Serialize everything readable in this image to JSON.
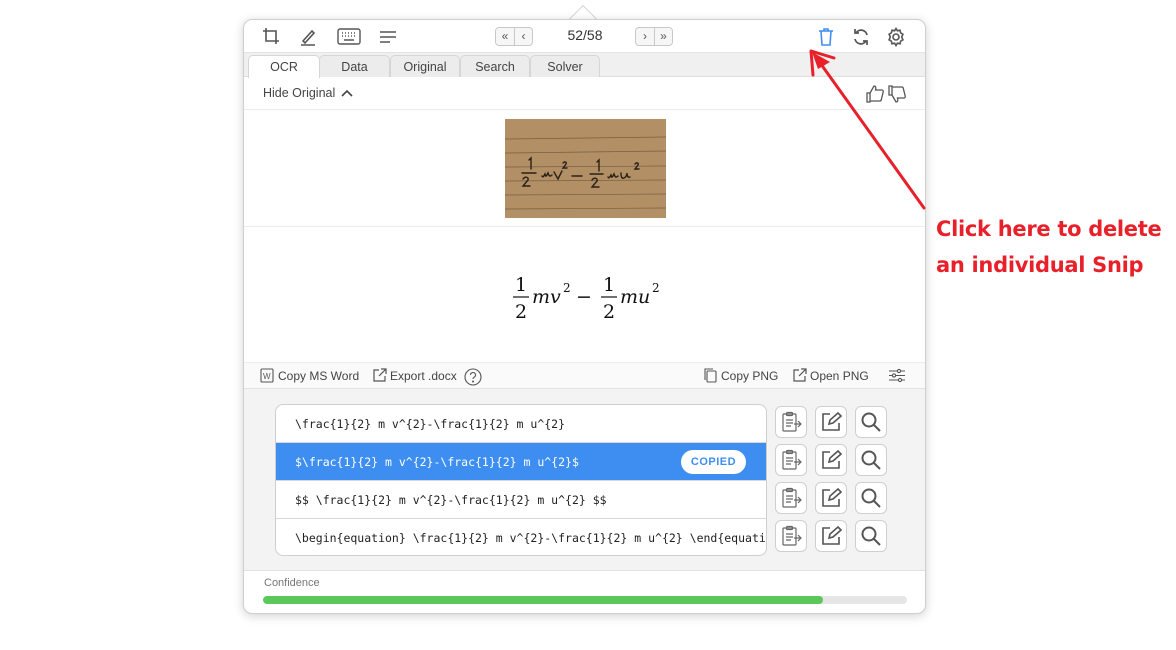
{
  "toolbar": {
    "counter": "52/58",
    "nav": {
      "first": "«",
      "prev": "‹",
      "next": "›",
      "last": "»"
    }
  },
  "tabs": [
    {
      "label": "OCR",
      "active": true
    },
    {
      "label": "Data"
    },
    {
      "label": "Original"
    },
    {
      "label": "Search"
    },
    {
      "label": "Solver"
    }
  ],
  "hide_original": "Hide Original",
  "rendered_math": {
    "num1": "1",
    "den1": "2",
    "num2": "1",
    "den2": "2"
  },
  "actions": {
    "copy_ms_word": "Copy MS Word",
    "export_docx": "Export .docx",
    "copy_png": "Copy PNG",
    "open_png": "Open PNG"
  },
  "results": [
    {
      "text": "\\frac{1}{2} m v^{2}-\\frac{1}{2} m u^{2}"
    },
    {
      "text": "$\\frac{1}{2} m v^{2}-\\frac{1}{2} m u^{2}$",
      "selected": true,
      "badge": "COPIED"
    },
    {
      "text": "$$ \\frac{1}{2} m v^{2}-\\frac{1}{2} m u^{2} $$"
    },
    {
      "text": "\\begin{equation} \\frac{1}{2} m v^{2}-\\frac{1}{2} m u^{2} \\end{equati…"
    }
  ],
  "confidence": {
    "label": "Confidence",
    "value": 0.87
  },
  "annotation": {
    "line1": "Click here to delete",
    "line2": "an individual Snip"
  },
  "colors": {
    "accent": "#3d8ef0",
    "confidence_bar": "#5ac85a",
    "annotation": "#e8202a",
    "trash_icon": "#3d8ef0"
  }
}
